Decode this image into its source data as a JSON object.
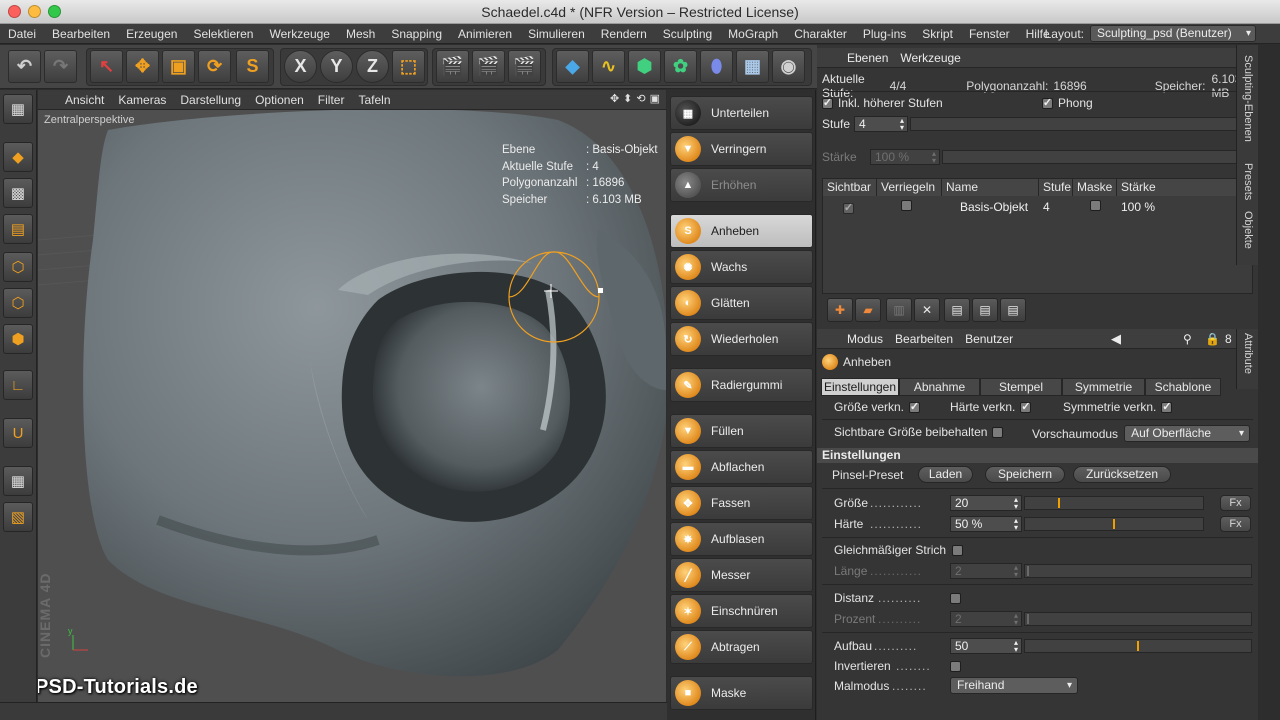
{
  "window": {
    "title": "Schaedel.c4d * (NFR Version – Restricted License)"
  },
  "menu": {
    "items": [
      "Datei",
      "Bearbeiten",
      "Erzeugen",
      "Selektieren",
      "Werkzeuge",
      "Mesh",
      "Snapping",
      "Animieren",
      "Simulieren",
      "Rendern",
      "Sculpting",
      "MoGraph",
      "Charakter",
      "Plug-ins",
      "Skript",
      "Fenster",
      "Hilfe"
    ],
    "layout_label": "Layout:",
    "layout_value": "Sculpting_psd (Benutzer)"
  },
  "toolbar": {
    "axis_x": "X",
    "axis_y": "Y",
    "axis_z": "Z"
  },
  "viewport": {
    "menu": [
      "Ansicht",
      "Kameras",
      "Darstellung",
      "Optionen",
      "Filter",
      "Tafeln"
    ],
    "perspective": "Zentralperspektive",
    "stats": [
      {
        "k": "Ebene",
        "v": ": Basis-Objekt"
      },
      {
        "k": "Aktuelle Stufe",
        "v": ": 4"
      },
      {
        "k": "Polygonanzahl",
        "v": ": 16896"
      },
      {
        "k": "Speicher",
        "v": ": 6.103 MB"
      }
    ],
    "watermark": "PSD-Tutorials.de",
    "maxon": "MAXON CINEMA 4D"
  },
  "brushes": [
    {
      "label": "Unterteilen",
      "state": "normal"
    },
    {
      "label": "Verringern",
      "state": "normal"
    },
    {
      "label": "Erhöhen",
      "state": "disabled"
    },
    {
      "label": "Anheben",
      "state": "active"
    },
    {
      "label": "Wachs",
      "state": "normal"
    },
    {
      "label": "Glätten",
      "state": "normal"
    },
    {
      "label": "Wiederholen",
      "state": "normal"
    },
    {
      "label": "Radiergummi",
      "state": "normal"
    },
    {
      "label": "Füllen",
      "state": "normal"
    },
    {
      "label": "Abflachen",
      "state": "normal"
    },
    {
      "label": "Fassen",
      "state": "normal"
    },
    {
      "label": "Aufblasen",
      "state": "normal"
    },
    {
      "label": "Messer",
      "state": "normal"
    },
    {
      "label": "Einschnüren",
      "state": "normal"
    },
    {
      "label": "Abtragen",
      "state": "normal"
    },
    {
      "label": "Maske",
      "state": "normal"
    }
  ],
  "layers_panel": {
    "tabs": [
      "Ebenen",
      "Werkzeuge"
    ],
    "current_level_label": "Aktuelle Stufe:",
    "current_level": "4/4",
    "polycount_label": "Polygonanzahl:",
    "polycount": "16896",
    "memory_label": "Speicher:",
    "memory": "6.103 MB",
    "incl_higher_label": "Inkl. höherer Stufen",
    "phong_label": "Phong",
    "level_label": "Stufe",
    "level_value": "4",
    "strength_label": "Stärke",
    "strength_value": "100 %",
    "columns": [
      "Sichtbar",
      "Verriegeln",
      "Name",
      "Stufe",
      "Maske",
      "Stärke"
    ],
    "rows": [
      {
        "name": "Basis-Objekt",
        "level": "4",
        "strength": "100 %"
      }
    ],
    "vtab_sculpting": "Sculpting-Ebenen",
    "vtab_presets": "Presets",
    "vtab_objects": "Objekte"
  },
  "attributes": {
    "menu": [
      "Modus",
      "Bearbeiten",
      "Benutzer"
    ],
    "tool_name": "Anheben",
    "tabs": [
      "Einstellungen",
      "Abnahme",
      "Stempel",
      "Symmetrie",
      "Schablone"
    ],
    "size_link": "Größe verkn.",
    "hardness_link": "Härte verkn.",
    "symmetry_link": "Symmetrie verkn.",
    "keep_size": "Sichtbare Größe beibehalten",
    "preview_mode_label": "Vorschaumodus",
    "preview_mode_value": "Auf Oberfläche",
    "section": "Einstellungen",
    "preset_label": "Pinsel-Preset",
    "btn_load": "Laden",
    "btn_save": "Speichern",
    "btn_reset": "Zurücksetzen",
    "size_label": "Größe",
    "size_value": "20",
    "size_fraction": 0.19,
    "hardness_label": "Härte",
    "hardness_value": "50 %",
    "hardness_fraction": 0.5,
    "fx": "Fx",
    "even_stroke": "Gleichmäßiger Strich",
    "length_label": "Länge",
    "length_value": "2",
    "distance_label": "Distanz",
    "percent_label": "Prozent",
    "percent_value": "2",
    "buildup_label": "Aufbau",
    "buildup_value": "50",
    "buildup_fraction": 0.5,
    "invert_label": "Invertieren",
    "paint_mode_label": "Malmodus",
    "paint_mode_value": "Freihand",
    "vtab": "Attribute"
  }
}
